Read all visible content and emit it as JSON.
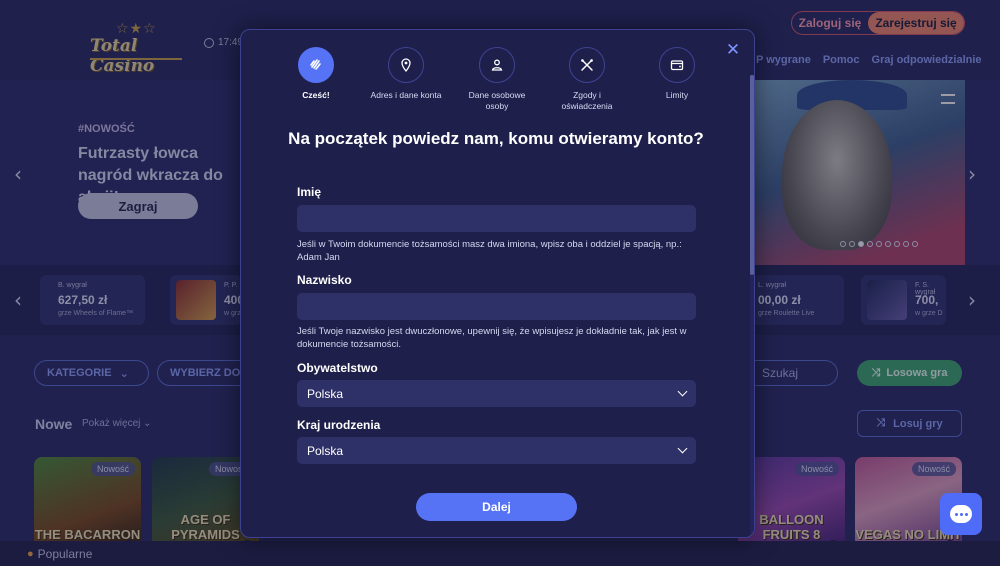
{
  "header": {
    "logo_text": "Total Casino",
    "time": "17:49",
    "login_label": "Zaloguj się",
    "register_label": "Zarejestruj się",
    "nav": [
      "P wygrane",
      "Pomoc",
      "Graj odpowiedzialnie"
    ]
  },
  "hero": {
    "tag": "#NOWOŚĆ",
    "title": "Futrzasty łowca nagród wkracza do akcji!",
    "play_label": "Zagraj",
    "dots_total": 9,
    "dots_active_index": 2
  },
  "winners": [
    {
      "name": "B. wygrał",
      "amount": "627,50 zł",
      "game": "grze Wheels of Flame™"
    },
    {
      "name": "P. P.",
      "amount": "400",
      "game": "w grz"
    },
    {
      "name": "L. wygrał",
      "amount": "00,00 zł",
      "game": "grze Roulette Live"
    },
    {
      "name": "F. S. wygrał",
      "amount": "700,",
      "game": "w grze D"
    }
  ],
  "filters": {
    "categories_label": "KATEGORIE",
    "provider_label": "WYBIERZ DOS",
    "search_placeholder": "Szukaj",
    "random_label": "Losowa gra",
    "lucky_label": "Losuj gry"
  },
  "section": {
    "title": "Nowe",
    "show_more": "Pokaż więcej"
  },
  "games": [
    {
      "name": "THE BACARRON",
      "badge": "Nowość"
    },
    {
      "name": "AGE OF PYRAMIDS",
      "badge": "Nowość"
    },
    {
      "name": "BALLOON FRUITS 8",
      "badge": "Nowość"
    },
    {
      "name": "VEGAS NO LIMIT",
      "badge": "Nowość"
    }
  ],
  "popular_label": "Popularne",
  "modal": {
    "steps": [
      {
        "label": "Cześć!",
        "icon": "wave-icon",
        "active": true
      },
      {
        "label": "Adres i dane konta",
        "icon": "location-icon",
        "active": false
      },
      {
        "label": "Dane osobowe osoby",
        "icon": "person-icon",
        "active": false
      },
      {
        "label": "Zgody i oświadczenia",
        "icon": "tools-icon",
        "active": false
      },
      {
        "label": "Limity",
        "icon": "wallet-icon",
        "active": false
      }
    ],
    "title": "Na początek powiedz nam, komu otwieramy konto?",
    "first_name": {
      "label": "Imię",
      "value": "",
      "hint": "Jeśli w Twoim dokumencie tożsamości masz dwa imiona, wpisz oba i oddziel je spacją, np.: Adam Jan"
    },
    "last_name": {
      "label": "Nazwisko",
      "value": "",
      "hint": "Jeśli Twoje nazwisko jest dwuczłonowe, upewnij się, że wpisujesz je dokładnie tak, jak jest w dokumencie tożsamości."
    },
    "citizenship": {
      "label": "Obywatelstwo",
      "value": "Polska"
    },
    "birth_country": {
      "label": "Kraj urodzenia",
      "value": "Polska"
    },
    "next_label": "Dalej"
  },
  "colors": {
    "accent": "#5673f5",
    "modal_bg": "#1e1f4a",
    "input_bg": "#2e3068",
    "success": "#3ea873",
    "register": "#f0876d"
  }
}
